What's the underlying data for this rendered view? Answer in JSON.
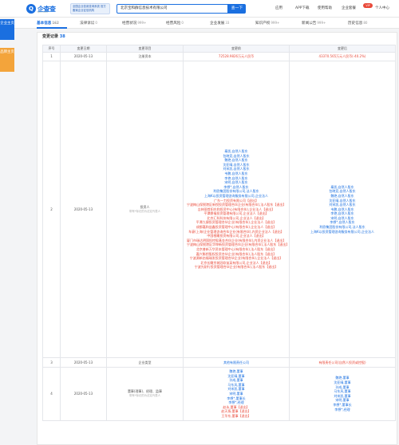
{
  "header": {
    "logo_text": "企查查",
    "logo_sub": "Qcc.com",
    "promo": "全国企业信用查询系统 官方备案企业征信机构",
    "search_value": "北京宝和群信息技术有限公司",
    "search_button": "查一下",
    "nav": [
      "应用",
      "APP下载",
      "使用帮助",
      "企业套餐"
    ],
    "vip": "VIP",
    "user": "个人中心"
  },
  "side_tabs": {
    "active": "企业主页",
    "inactive": "品牌主页"
  },
  "subnav": {
    "items": [
      {
        "label": "基本信息",
        "count": "162"
      },
      {
        "label": "法律诉讼",
        "count": "0"
      },
      {
        "label": "经营状况",
        "count": "999+"
      },
      {
        "label": "经营风险",
        "count": "0"
      },
      {
        "label": "企业发展",
        "count": "33"
      },
      {
        "label": "知识产权",
        "count": "999+"
      },
      {
        "label": "新闻公告",
        "count": "999+"
      },
      {
        "label": "历史信息",
        "count": "80"
      }
    ]
  },
  "changes": {
    "title": "变更记录",
    "count": "38",
    "columns": [
      "序号",
      "变更日期",
      "变更项目",
      "变更前",
      "变更后"
    ],
    "rows": [
      {
        "seq": "1",
        "date": "2020-05-13",
        "item": "注册资本",
        "item_hint": "",
        "before_type": "capital",
        "before": [
          "72528.9826万元人民币"
        ],
        "after": [
          "43370.565万元人民币(-40.2%)"
        ]
      },
      {
        "seq": "2",
        "date": "2020-05-13",
        "item": "投资人",
        "item_hint": "带有*标记的为法定代表人",
        "before": [
          "秦凯,自然人股东",
          "包晓竞,自然人股东",
          "魏艳,自然人股东",
          "沈亚晴,自然人股东",
          "刘宋凯,自然人股东",
          "韦鹏,自然人股东",
          "李艳,自然人股东",
          "宋明,自然人股东",
          "李想*,自然人股东",
          "利欧集团股份有限公司,法人股东",
          "上海K以投资管理咨询服务有限公司,企业法人",
          "广东一力投资有限公司【退出】",
          "宁波梅山保税港区新悦投资管理合伙企业(有限合伙),法人股东【退出】",
          "吉林银首阳东和投资中心(有限合伙),企业法人【退出】",
          "平潭鼎福投资管理有限公司,企业法人【退出】",
          "北京汇科科技有限公司,企业法人【退出】",
          "平潭九捷投资管理合伙企业(有限合伙),企业法人【退出】",
          "成都嘉和益鑫投资管理中心(有限合伙),企业法人【退出】",
          "车豪(上海)企业管理咨询合伙企业(有限合伙),内资企业法人【退出】",
          "中国根雕投资有限公司,企业法人【退出】",
          "厦门市瑞达明国投控股基金合伙企业(有限合伙),内资企业法人【退出】",
          "宁波梅山保税港区华坤新投资管理合伙企业(有限合伙),法人股东【退出】",
          "北京普新万华资本管理中心(有限合伙),法人股东【退出】",
          "嘉兴衡钥股权投资合伙企业(有限合伙),法人股东【退出】",
          "宁波源新启福瑞发投资管理合伙企业(有限合伙),企业法人【退出】",
          "北京长瞰京城冠软苗英有限公司,企业法人【退出】",
          "宁波光耐行投资管理合伙企业(有限合伙),法人股东【退出】"
        ],
        "after": [
          "秦凯,自然人股东",
          "包晓竞,自然人股东",
          "魏艳,自然人股东",
          "沈亚晴,自然人股东",
          "刘宋凯,自然人股东",
          "韦鹏,自然人股东",
          "李艳,自然人股东",
          "宋明,自然人股东",
          "李想*,自然人股东",
          "利欧集团股份有限公司,法人股东",
          "上海K以投资管理咨询服务有限公司,企业法人"
        ]
      },
      {
        "seq": "3",
        "date": "2020-05-13",
        "item": "企业类型",
        "item_hint": "",
        "before": [
          "其他有限责任公司"
        ],
        "after": [
          "有限责任公司(自然人投资或控股)"
        ]
      },
      {
        "seq": "4",
        "date": "2020-05-13",
        "item": "董事(理事)、经理、监事",
        "item_hint": "带有*标记的为法定代表人",
        "before": [
          "魏艳,董事",
          "沈亚晴,董事",
          "孙成,董事",
          "马东风,董事",
          "刘宋凯,董事",
          "宋明,董事",
          "李想*,董事长",
          "李想*,经理",
          "赵永,董事【退出】",
          "赵天扬,董事【退出】",
          "王华东,董事【退出】"
        ],
        "after": [
          "魏艳,董事",
          "沈亚晴,董事",
          "孙成,董事",
          "马东风,董事",
          "刘宋凯,董事",
          "宋明,董事",
          "李想*,董事长",
          "李想*,经理"
        ]
      }
    ]
  }
}
